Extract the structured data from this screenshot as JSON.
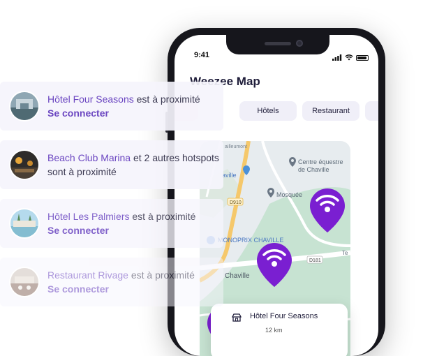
{
  "phone": {
    "status_time": "9:41",
    "app_title": "Weezee Map",
    "chips": [
      "",
      "Hôtels",
      "Restaurant",
      ""
    ],
    "map_labels": {
      "centre_equestre_line1": "Centre équestre",
      "centre_equestre_line2": "de Chaville",
      "mosquee": "Mosquée",
      "monoprix": "MONOPRIX CHAVILLE",
      "chaville": "Chaville",
      "chaville_station": "aville",
      "road_d910": "D910",
      "road_d181": "D181",
      "te": "Te",
      "street_top": "ailleumont"
    },
    "detail_card": {
      "name": "Hôtel Four Seasons",
      "distance": "12 km"
    }
  },
  "notifications": [
    {
      "place": "Hôtel Four Seasons",
      "message": " est à proximité",
      "action": "Se connecter"
    },
    {
      "place": "Beach Club Marina",
      "message": " et 2 autres hotspots sont à proximité",
      "action": ""
    },
    {
      "place": "Hôtel Les Palmiers",
      "message": " est à proximité",
      "action": "Se connecter"
    },
    {
      "place": "Restaurant Rivage",
      "message": " est à proximité",
      "action": "Se connecter"
    }
  ],
  "colors": {
    "accent": "#7a1fd1",
    "brand_text": "#6b46c1",
    "chip_bg": "#f0eff8"
  },
  "icons": [
    "wifi-pin-icon",
    "hotel-icon",
    "location-pin-icon",
    "signal-icon",
    "wifi-icon",
    "battery-icon"
  ]
}
